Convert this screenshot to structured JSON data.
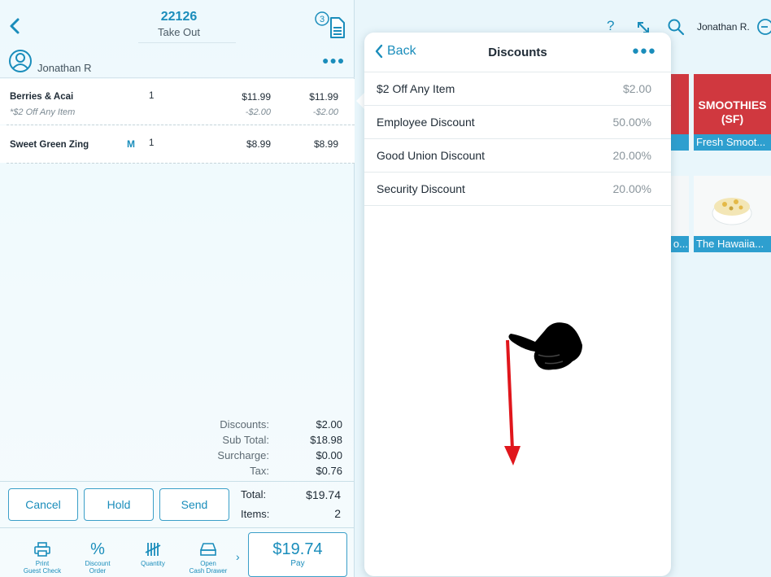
{
  "order": {
    "number": "22126",
    "type": "Take Out",
    "guest_count": "3",
    "customer": "Jonathan R",
    "items": [
      {
        "name": "Berries & Acai",
        "qty": "1",
        "price": "$11.99",
        "total": "$11.99",
        "modifier": "*$2 Off Any Item",
        "modifier_price": "-$2.00",
        "modifier_total": "-$2.00"
      },
      {
        "name": "Sweet Green Zing",
        "mark": "M",
        "qty": "1",
        "price": "$8.99",
        "total": "$8.99"
      }
    ],
    "summary": [
      {
        "label": "Discounts:",
        "value": "$2.00"
      },
      {
        "label": "Sub Total:",
        "value": "$18.98"
      },
      {
        "label": "Surcharge:",
        "value": "$0.00"
      },
      {
        "label": "Tax:",
        "value": "$0.76"
      }
    ],
    "total_label": "Total:",
    "total_value": "$19.74",
    "items_label": "Items:",
    "items_value": "2",
    "buttons": {
      "cancel": "Cancel",
      "hold": "Hold",
      "send": "Send"
    },
    "tools": [
      {
        "label": "Print\nGuest Check",
        "icon": "printer-icon"
      },
      {
        "label": "Discount\nOrder",
        "icon": "percent-icon"
      },
      {
        "label": "Quantity",
        "icon": "tally-icon"
      },
      {
        "label": "Open\nCash Drawer",
        "icon": "cash-drawer-icon"
      }
    ],
    "pay": {
      "amount": "$19.74",
      "label": "Pay"
    }
  },
  "topbar": {
    "help": "?",
    "user": "Jonathan R."
  },
  "catalog": {
    "tiles": [
      {
        "title": "SMOOTHIES\n(SF)",
        "caption": "Fresh Smoot..."
      },
      {
        "caption": "The Hawaiia..."
      },
      {
        "caption": "o..."
      }
    ]
  },
  "discounts": {
    "back": "Back",
    "title": "Discounts",
    "rows": [
      {
        "name": "$2 Off Any Item",
        "value": "$2.00"
      },
      {
        "name": "Employee Discount",
        "value": "50.00%"
      },
      {
        "name": "Good Union Discount",
        "value": "20.00%"
      },
      {
        "name": "Security Discount",
        "value": "20.00%"
      }
    ]
  },
  "colors": {
    "accent": "#1a8dbb",
    "tile_red": "#d0383f",
    "gesture_arrow": "#e0161c"
  }
}
